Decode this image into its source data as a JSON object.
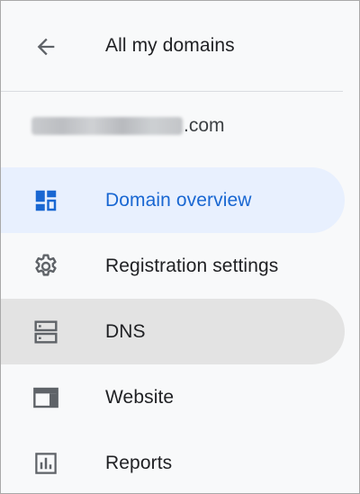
{
  "header": {
    "title": "All my domains",
    "back_icon": "arrow-back-icon"
  },
  "domain": {
    "suffix": ".com"
  },
  "colors": {
    "accent": "#1967d2",
    "selected_bg": "#e8f0fe",
    "hover_bg": "#e3e3e3",
    "text": "#202124",
    "icon_gray": "#5f6368"
  },
  "nav": {
    "items": [
      {
        "label": "Domain overview",
        "icon": "dashboard-icon",
        "state": "selected"
      },
      {
        "label": "Registration settings",
        "icon": "gear-icon",
        "state": ""
      },
      {
        "label": "DNS",
        "icon": "dns-icon",
        "state": "hovered"
      },
      {
        "label": "Website",
        "icon": "web-icon",
        "state": ""
      },
      {
        "label": "Reports",
        "icon": "reports-icon",
        "state": ""
      }
    ]
  }
}
